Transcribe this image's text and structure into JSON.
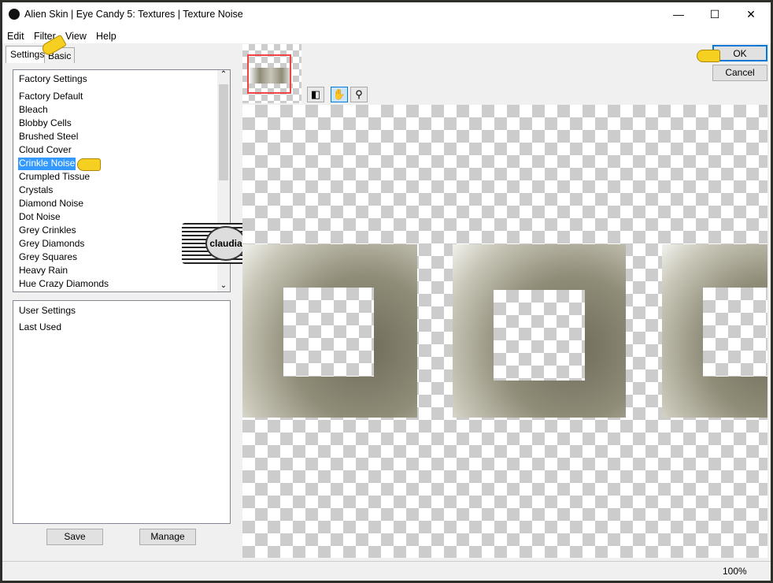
{
  "window": {
    "title": "Alien Skin | Eye Candy 5: Textures | Texture Noise"
  },
  "menu": [
    "Edit",
    "Filter",
    "View",
    "Help"
  ],
  "tabs": [
    {
      "label": "Settings",
      "active": true
    },
    {
      "label": "Basic",
      "active": false
    }
  ],
  "factory": {
    "header": "Factory Settings",
    "selected": "Crinkle Noise",
    "items": [
      "Factory Default",
      "Bleach",
      "Blobby Cells",
      "Brushed Steel",
      "Cloud Cover",
      "Crinkle Noise",
      "Crumpled Tissue",
      "Crystals",
      "Diamond Noise",
      "Dot Noise",
      "Grey Crinkles",
      "Grey Diamonds",
      "Grey Squares",
      "Heavy Rain",
      "Hue Crazy Diamonds"
    ]
  },
  "user": {
    "header": "User Settings",
    "items": [
      "Last Used"
    ]
  },
  "buttons": {
    "save": "Save",
    "manage": "Manage",
    "ok": "OK",
    "cancel": "Cancel"
  },
  "tools": [
    "preview-toggle-icon",
    "hand-icon",
    "zoom-icon"
  ],
  "status": {
    "zoom": "100%"
  },
  "watermark": "claudia",
  "colors": {
    "selection": "#3399ff",
    "default_button_border": "#0078d7",
    "preview_rect": "#ee4444"
  }
}
